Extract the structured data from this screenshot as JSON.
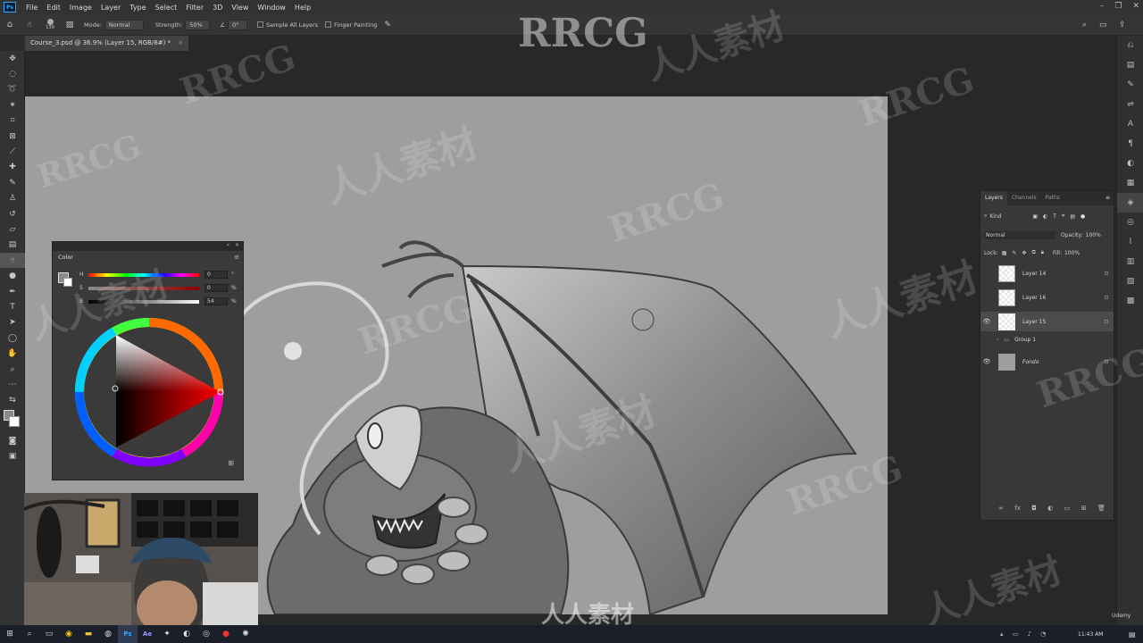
{
  "app": {
    "logo_text": "Ps",
    "menu": [
      "File",
      "Edit",
      "Image",
      "Layer",
      "Type",
      "Select",
      "Filter",
      "3D",
      "View",
      "Window",
      "Help"
    ]
  },
  "options_bar": {
    "brush_size": "139",
    "mode_label": "Mode:",
    "mode_value": "Normal",
    "strength_label": "Strength:",
    "strength_value": "50%",
    "angle_value": "0°",
    "sample_all_layers": "Sample All Layers",
    "finger_painting": "Finger Painting"
  },
  "document": {
    "tab_title": "Course_3.psd @ 36.9% (Layer 15, RGB/8#) *"
  },
  "color_panel": {
    "tab": "Color",
    "h_label": "H",
    "h_value": "0",
    "h_unit": "°",
    "s_label": "S",
    "s_value": "0",
    "s_unit": "%",
    "b_label": "B",
    "b_value": "54",
    "b_unit": "%"
  },
  "layers_panel": {
    "tabs": [
      "Layers",
      "Channels",
      "Paths"
    ],
    "filter_kind": "Kind",
    "blend_mode": "Normal",
    "opacity_label": "Opacity:",
    "opacity_value": "100%",
    "lock_label": "Lock:",
    "fill_label": "Fill:",
    "fill_value": "100%",
    "layers": [
      {
        "name": "Layer 14"
      },
      {
        "name": "Layer 16"
      },
      {
        "name": "Layer 15"
      },
      {
        "name": "Group 1"
      },
      {
        "name": "Fondo"
      }
    ]
  },
  "watermarks": {
    "brand": "RRCG",
    "cn": "人人素材"
  },
  "taskbar": {
    "time": "11:43 AM",
    "udemy": "Udemy"
  },
  "colors": {
    "accent": "#31a8ff",
    "canvas": "#9e9e9e",
    "panel": "#383838"
  }
}
